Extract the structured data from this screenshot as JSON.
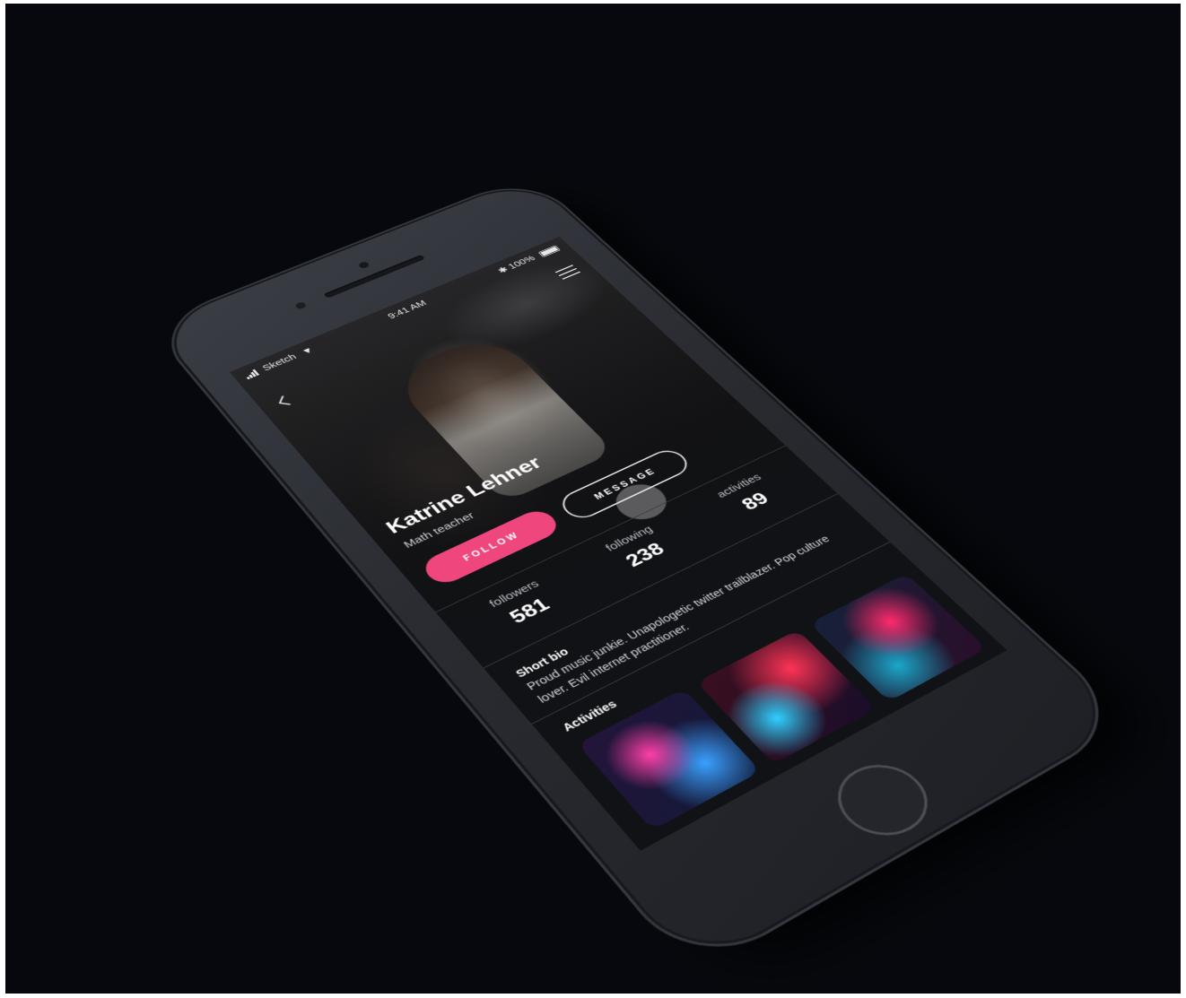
{
  "status_bar": {
    "carrier": "Sketch",
    "time": "9:41 AM",
    "battery": "100%"
  },
  "profile": {
    "name": "Katrine Lehner",
    "role": "Math teacher"
  },
  "actions": {
    "follow_label": "FOLLOW",
    "message_label": "MESSAGE"
  },
  "stats": [
    {
      "label": "followers",
      "value": "581"
    },
    {
      "label": "following",
      "value": "238"
    },
    {
      "label": "activities",
      "value": "89"
    }
  ],
  "bio": {
    "title": "Short bio",
    "text": "Proud music junkie. Unapologetic twitter trailblazer. Pop culture lover. Evil internet practitioner."
  },
  "activities": {
    "title": "Activities"
  },
  "icons": {
    "back": "chevron-left-icon",
    "menu": "hamburger-menu-icon",
    "signal": "signal-icon",
    "wifi": "wifi-icon",
    "bluetooth": "bluetooth-icon",
    "battery": "battery-icon"
  },
  "colors": {
    "accent": "#f0467e",
    "background": "#06080d",
    "screen": "#111215"
  }
}
